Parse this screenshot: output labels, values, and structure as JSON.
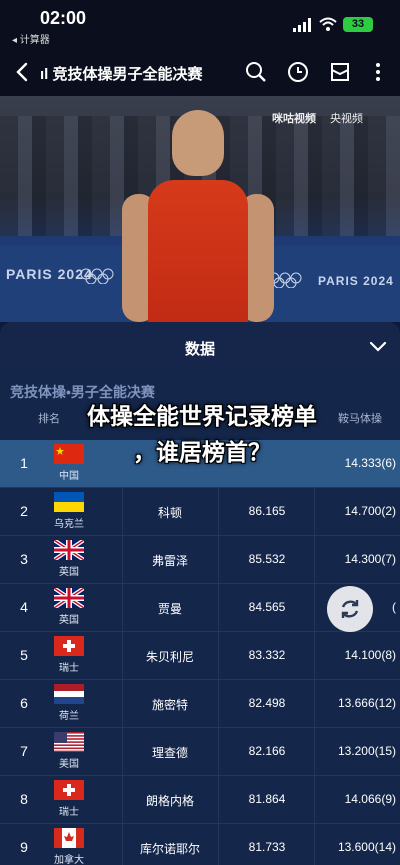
{
  "status": {
    "time": "02:00",
    "back_app": "◂ 计算器",
    "battery": "33"
  },
  "appbar": {
    "title": "ıl 竞技体操男子全能决赛"
  },
  "video": {
    "watermark_left": "咪咕视频",
    "watermark_right": "央视频",
    "venue_left": "PARIS 2024",
    "venue_right": "PARIS 2024"
  },
  "sheet": {
    "label": "数据"
  },
  "table": {
    "title": "竞技体操•男子全能决赛",
    "headers": {
      "rank": "排名",
      "app": "鞍马体操"
    },
    "rows": [
      {
        "rank": "1",
        "country": "中国",
        "name": "",
        "total": "",
        "app": "14.333(6)",
        "flag": "china"
      },
      {
        "rank": "2",
        "country": "乌克兰",
        "name": "科顿",
        "total": "86.165",
        "app": "14.700(2)",
        "flag": "ukraine"
      },
      {
        "rank": "3",
        "country": "英国",
        "name": "弗雷泽",
        "total": "85.532",
        "app": "14.300(7)",
        "flag": "uk"
      },
      {
        "rank": "4",
        "country": "英国",
        "name": "贾曼",
        "total": "84.565",
        "app": "(",
        "flag": "uk"
      },
      {
        "rank": "5",
        "country": "瑞士",
        "name": "朱贝利尼",
        "total": "83.332",
        "app": "14.100(8)",
        "flag": "switzerland"
      },
      {
        "rank": "6",
        "country": "荷兰",
        "name": "施密特",
        "total": "82.498",
        "app": "13.666(12)",
        "flag": "netherlands"
      },
      {
        "rank": "7",
        "country": "美国",
        "name": "理查德",
        "total": "82.166",
        "app": "13.200(15)",
        "flag": "usa"
      },
      {
        "rank": "8",
        "country": "瑞士",
        "name": "朗格内格",
        "total": "81.864",
        "app": "14.066(9)",
        "flag": "switzerland"
      },
      {
        "rank": "9",
        "country": "加拿大",
        "name": "库尔诺耶尔",
        "total": "81.733",
        "app": "13.600(14)",
        "flag": "canada"
      }
    ]
  },
  "headline": {
    "line1": "体操全能世界记录榜单",
    "line2": "，谁居榜首？"
  },
  "colors": {
    "accent_row": "#2e5a8a",
    "sheet_bg": "#14264a",
    "battery": "#2ecc40"
  }
}
